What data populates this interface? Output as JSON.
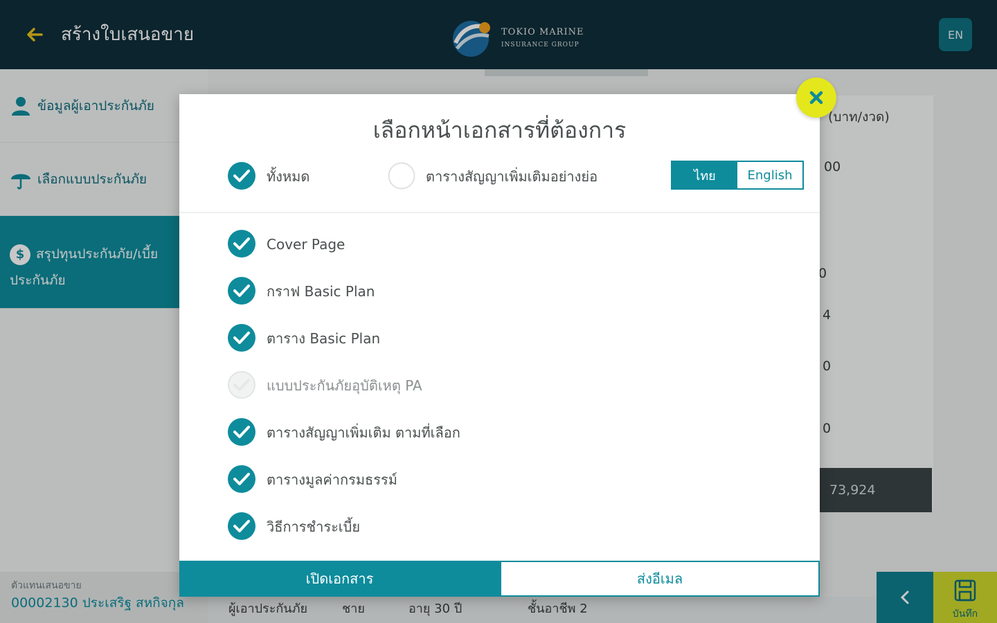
{
  "header": {
    "title": "สร้างใบเสนอขาย",
    "logo_line1": "TOKIO MARINE",
    "logo_line2": "INSURANCE GROUP",
    "lang_button": "EN"
  },
  "sidebar": {
    "items": [
      {
        "label": "ข้อมูลผู้เอาประกันภัย",
        "icon": "person-icon"
      },
      {
        "label": "เลือกแบบประกันภัย",
        "icon": "umbrella-icon"
      },
      {
        "label_line1": "สรุปทุนประกันภัย/เบี้ย",
        "label_line2": "ประกันภัย",
        "icon": "dollar-icon",
        "active": true
      }
    ]
  },
  "agent": {
    "label": "ตัวแทนเสนอขาย",
    "value": "00002130 ประเสริฐ สหกิจกุล"
  },
  "background": {
    "unit_label": "(บาท/งวด)",
    "value_a": "00",
    "value_b": "0",
    "value_c": "4",
    "value_d": "0",
    "value_e": "0",
    "total": "73,924",
    "bottom_text_1": "ผู้เอาประกันภัย",
    "bottom_text_2": "ชาย",
    "bottom_text_3": "อายุ 30 ปี",
    "bottom_text_4": "ชั้นอาชีพ 2",
    "save_label": "บันทึก"
  },
  "modal": {
    "title": "เลือกหน้าเอกสารที่ต้องการ",
    "select_all": {
      "label": "ทั้งหมด",
      "checked": true
    },
    "summary_option": {
      "label": "ตารางสัญญาเพิ่มเติมอย่างย่อ",
      "checked": false
    },
    "language": {
      "thai": "ไทย",
      "english": "English",
      "selected": "thai"
    },
    "options": [
      {
        "label": "Cover Page",
        "checked": true,
        "enabled": true
      },
      {
        "label": "กราฟ Basic Plan",
        "checked": true,
        "enabled": true
      },
      {
        "label": "ตาราง Basic Plan",
        "checked": true,
        "enabled": true
      },
      {
        "label": "แบบประกันภัยอุบัติเหตุ PA",
        "checked": false,
        "enabled": false
      },
      {
        "label": "ตารางสัญญาเพิ่มเติม ตามที่เลือก",
        "checked": true,
        "enabled": true
      },
      {
        "label": "ตารางมูลค่ากรมธรรม์",
        "checked": true,
        "enabled": true
      },
      {
        "label": "วิธีการชำระเบี้ย",
        "checked": true,
        "enabled": true
      }
    ],
    "open_button": "เปิดเอกสาร",
    "email_button": "ส่งอีเมล"
  },
  "colors": {
    "primary": "#0e8c9c",
    "header_bg": "#0f2f3a",
    "accent_yellow": "#e3e71c"
  }
}
